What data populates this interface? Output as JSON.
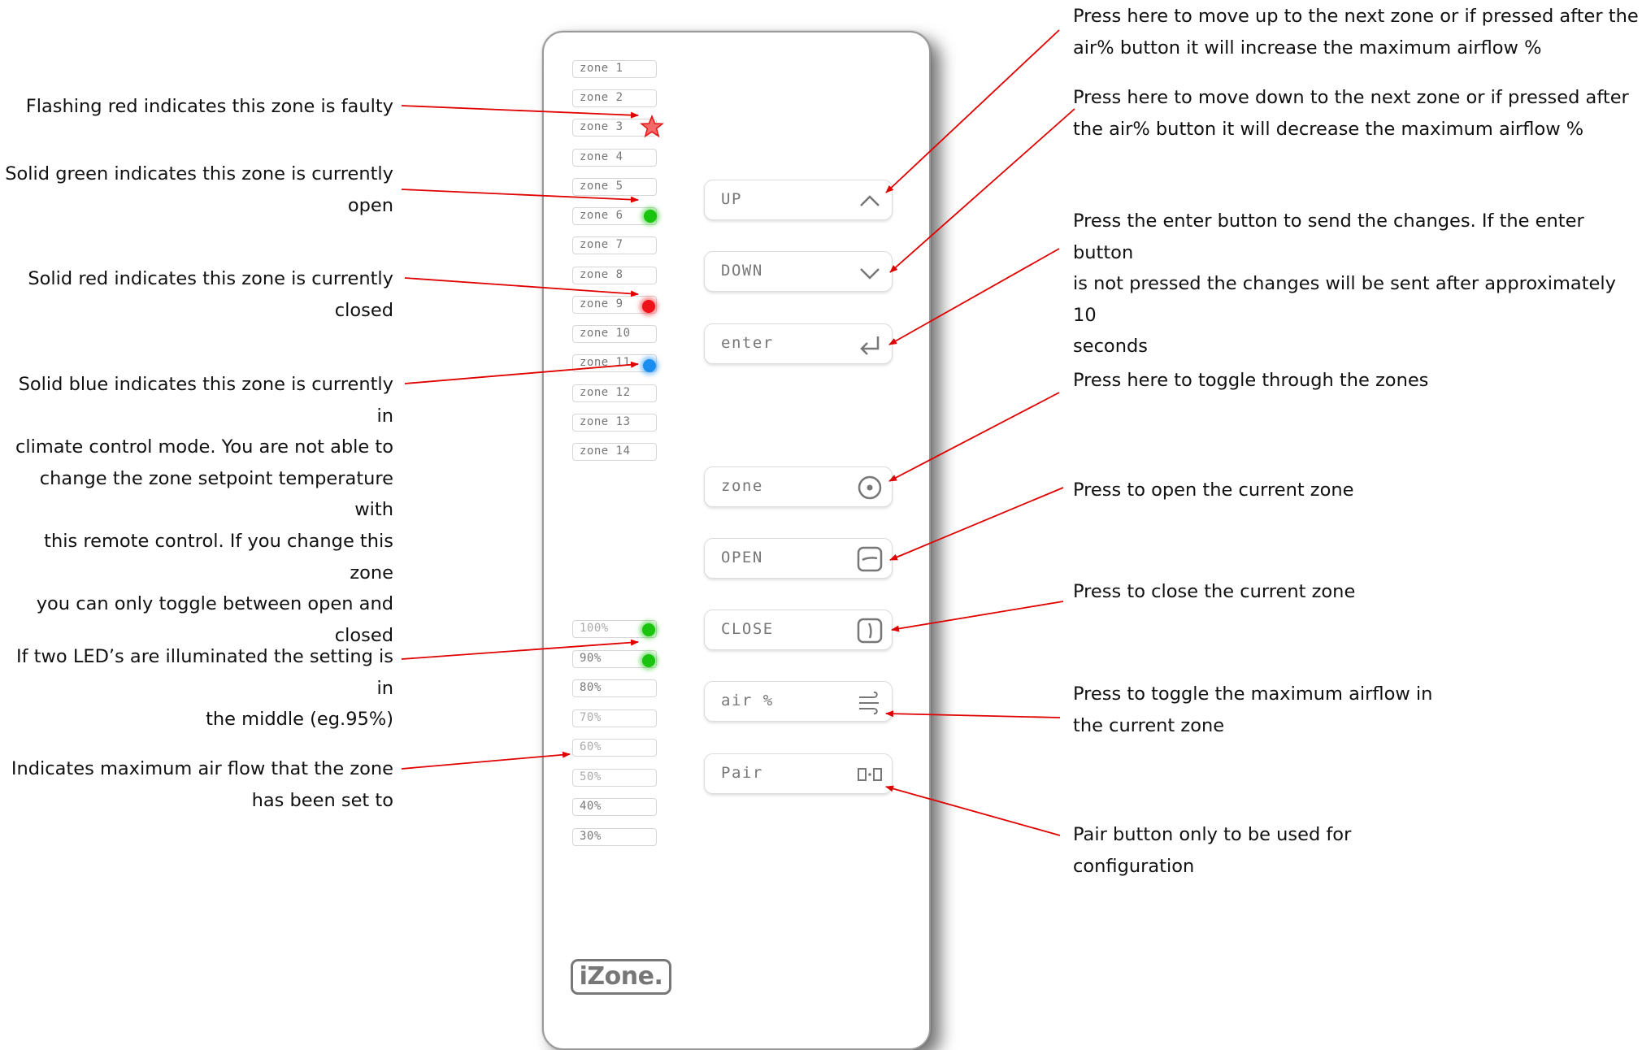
{
  "annotations_left": [
    {
      "lines": [
        "Flashing red indicates this zone is faulty"
      ]
    },
    {
      "lines": [
        "Solid green indicates this zone is currently",
        "open"
      ]
    },
    {
      "lines": [
        "Solid red indicates this zone is currently",
        "closed"
      ]
    },
    {
      "lines": [
        "Solid blue indicates this zone is currently in",
        "climate control mode. You are not able to",
        "change the zone setpoint temperature with",
        "this remote control. If you change this zone",
        "you can only toggle between open and",
        "closed"
      ]
    },
    {
      "lines": [
        "If two LED’s are illuminated the setting is in",
        "the middle (eg.95%)"
      ]
    },
    {
      "lines": [
        "Indicates maximum air flow that the zone",
        "has been set to"
      ]
    }
  ],
  "annotations_right": [
    {
      "lines": [
        "Press here to move up to the next zone or if pressed after the",
        "air% button it will increase the maximum airflow %"
      ]
    },
    {
      "lines": [
        "Press here to move down to the next zone or if pressed after",
        "the air% button it will decrease the maximum airflow %"
      ]
    },
    {
      "lines": [
        "Press the enter button to send the changes. If the enter button",
        "is not pressed the changes will be sent after approximately 10",
        "seconds"
      ]
    },
    {
      "lines": [
        "Press here to toggle through the zones"
      ]
    },
    {
      "lines": [
        "Press to open the current zone"
      ]
    },
    {
      "lines": [
        "Press to close the current zone"
      ]
    },
    {
      "lines": [
        "Press to toggle the maximum airflow in",
        "the current zone"
      ]
    },
    {
      "lines": [
        "Pair button only to be used for",
        "configuration"
      ]
    }
  ],
  "remote": {
    "zones": [
      "zone 1",
      "zone 2",
      "zone 3",
      "zone 4",
      "zone 5",
      "zone 6",
      "zone 7",
      "zone 8",
      "zone 9",
      "zone 10",
      "zone 11",
      "zone 12",
      "zone 13",
      "zone 14"
    ],
    "airflow": [
      "100%",
      "90%",
      "80%",
      "70%",
      "60%",
      "50%",
      "40%",
      "30%"
    ],
    "buttons": [
      {
        "label": "UP",
        "icon": "chevron-up-icon"
      },
      {
        "label": "DOWN",
        "icon": "chevron-down-icon"
      },
      {
        "label": "enter",
        "icon": "enter-icon"
      },
      {
        "label": "zone",
        "icon": "zone-dial-icon"
      },
      {
        "label": "OPEN",
        "icon": "open-damper-icon"
      },
      {
        "label": "CLOSE",
        "icon": "close-damper-icon"
      },
      {
        "label": "air %",
        "icon": "airflow-icon"
      },
      {
        "label": "Pair",
        "icon": "pair-icon"
      }
    ],
    "leds": [
      {
        "target": "zone 3",
        "state": "flashing red",
        "color": "#f0121a"
      },
      {
        "target": "zone 6",
        "state": "solid green",
        "color": "#19c30e"
      },
      {
        "target": "zone 9",
        "state": "solid red",
        "color": "#f0121a"
      },
      {
        "target": "zone 11",
        "state": "solid blue",
        "color": "#1a8df0"
      },
      {
        "target": "100%",
        "state": "solid green",
        "color": "#19c30e"
      },
      {
        "target": "90%",
        "state": "solid green",
        "color": "#19c30e"
      }
    ],
    "logo": "iZone."
  },
  "colors": {
    "arrow": "#e00000",
    "text": "#111111"
  }
}
